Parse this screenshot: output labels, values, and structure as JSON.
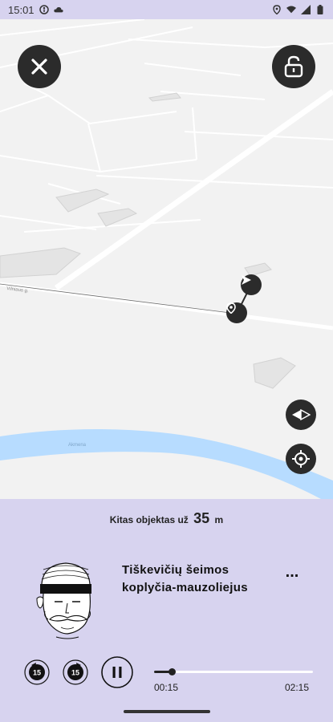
{
  "status_bar": {
    "time": "15:01",
    "icons_left": [
      "accessibility-icon",
      "cloud-icon"
    ],
    "icons_right": [
      "location-icon",
      "wifi-icon",
      "signal-icon",
      "battery-icon"
    ]
  },
  "map": {
    "street_label": "Vilniaus g.",
    "river_label": "Akmena",
    "colors": {
      "water": "#b7dcff",
      "ground": "#f2f2f2",
      "road": "#ffffff"
    }
  },
  "buttons": {
    "close_icon": "close-icon",
    "lock_icon": "unlock-icon",
    "compass_icon": "compass-icon",
    "locate_icon": "crosshair-icon"
  },
  "player": {
    "next_label": "Kitas objektas už",
    "next_distance": "35",
    "next_unit": "m",
    "title": "Tiškevičių šeimos koplyčia-mauzoliejus",
    "more": "...",
    "rewind_label": "15",
    "forward_label": "15",
    "current_time": "00:15",
    "total_time": "02:15",
    "progress": 0.11
  },
  "colors": {
    "panel": "#d7d3ef",
    "accent": "#2b2b2b"
  }
}
